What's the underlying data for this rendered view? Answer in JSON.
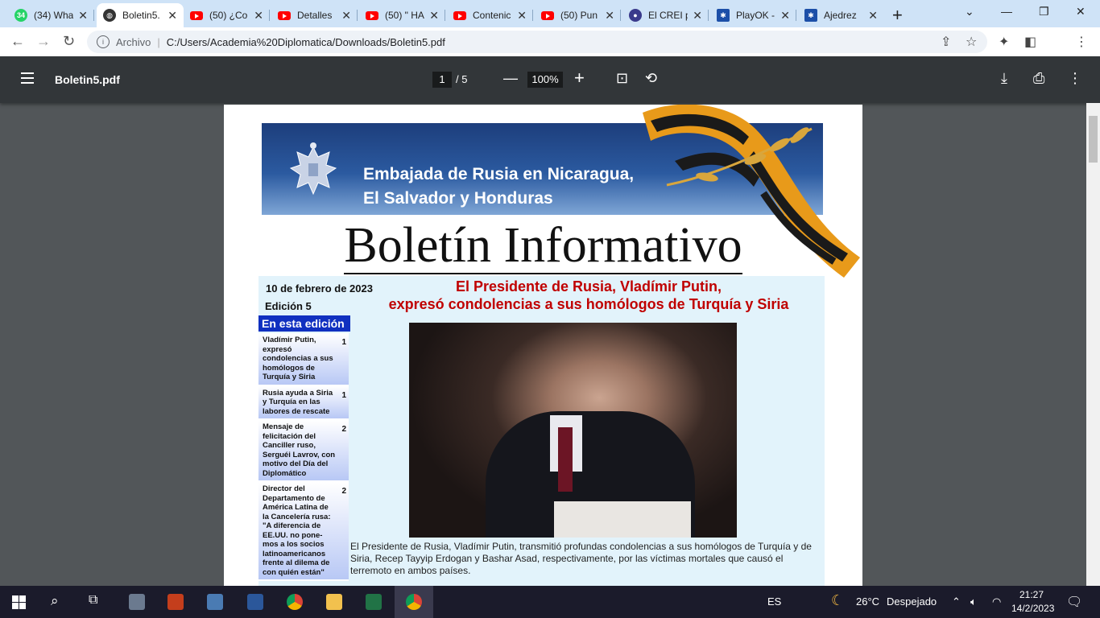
{
  "tabs": [
    {
      "title": "(34) Wha",
      "icon": "whatsapp-icon",
      "badge": "34"
    },
    {
      "title": "Boletin5.",
      "icon": "globe-icon",
      "active": true
    },
    {
      "title": "(50) ¿Co",
      "icon": "youtube-icon"
    },
    {
      "title": "Detalles",
      "icon": "youtube-icon"
    },
    {
      "title": "(50) \" HA",
      "icon": "youtube-icon"
    },
    {
      "title": "Contenic",
      "icon": "youtube-icon"
    },
    {
      "title": "(50) Pun",
      "icon": "youtube-icon"
    },
    {
      "title": "El CREI p",
      "icon": "crei-icon"
    },
    {
      "title": "PlayOK -",
      "icon": "playok-icon"
    },
    {
      "title": "Ajedrez",
      "icon": "playok-icon"
    }
  ],
  "address": {
    "scheme": "Archivo",
    "url": "C:/Users/Academia%20Diplomatica/Downloads/Boletin5.pdf"
  },
  "pdf": {
    "filename": "Boletin5.pdf",
    "page": "1",
    "total_pages": "/  5",
    "zoom": "100%"
  },
  "doc": {
    "banner_line1": "Embajada de Rusia en Nicaragua,",
    "banner_line2": "El Salvador y Honduras",
    "title": "Boletín Informativo",
    "date": "10 de febrero de 2023",
    "edition": "Edición  5",
    "headline_line1": "El Presidente de Rusia, Vladímir Putin,",
    "headline_line2": "expresó condolencias a sus homólogos de Turquía y Siria",
    "toc_header": "En esta edición",
    "toc": [
      {
        "text": "Vladímir Putin, expresó condolencias a sus homólogos de Turquía y Siria",
        "page": "1"
      },
      {
        "text": "Rusia ayuda a Siria y Turquía en las labores de rescate",
        "page": "1"
      },
      {
        "text": "Mensaje de felicitación del Canciller ruso, Serguéi Lavrov, con motivo del Día del Diplomático",
        "page": "2"
      },
      {
        "text": "Director del Departamento de América Latina de la Cancelería rusa: \"A diferencia de EE.UU. no pone-mos a los socios latinoamericanos frente al dilema de con quién están\"",
        "page": "2"
      }
    ],
    "caption": "El Presidente de Rusia, Vladímir Putin, transmitió profundas condolencias a sus homólogos de Turquía y de Siria, Recep Tayyip Erdogan y Bashar Asad, respectivamente, por las víctimas mortales que causó el terremoto en ambos países."
  },
  "taskbar": {
    "language": "ES",
    "temperature": "26°C",
    "weather": "Despejado",
    "time": "21:27",
    "date": "14/2/2023"
  }
}
